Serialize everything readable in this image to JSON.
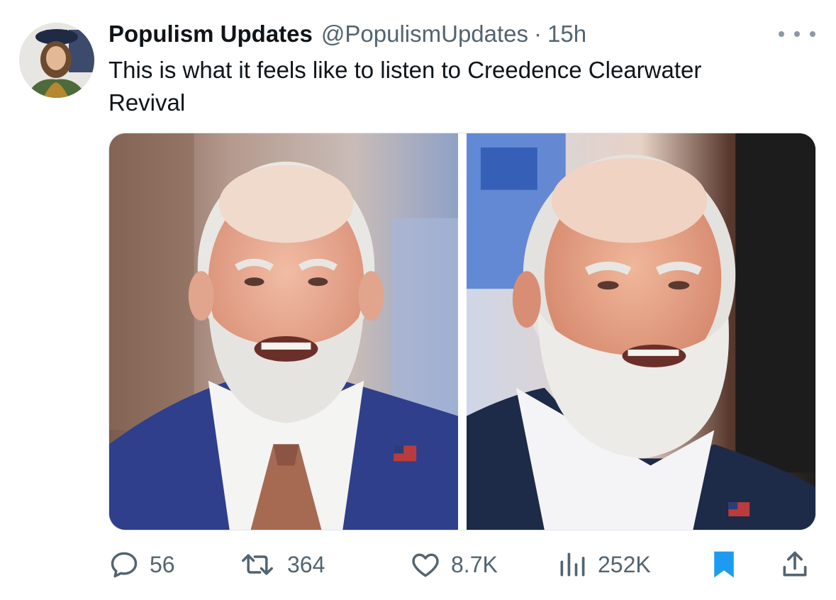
{
  "author": {
    "display_name": "Populism Updates",
    "handle": "@PopulismUpdates",
    "separator": "·",
    "time": "15h"
  },
  "tweet": {
    "text": "This is what it feels like to listen to Creedence Clearwater\nRevival"
  },
  "media": [
    {
      "description": "photo-left"
    },
    {
      "description": "photo-right"
    }
  ],
  "actions": {
    "replies": "56",
    "retweets": "364",
    "likes": "8.7K",
    "views": "252K"
  },
  "icons": {
    "reply": "speech-bubble-icon",
    "retweet": "retweet-arrows-icon",
    "like": "heart-icon",
    "views": "bar-chart-icon",
    "bookmark": "bookmark-icon",
    "share": "share-upload-icon",
    "more": "ellipsis-icon"
  },
  "colors": {
    "text_primary": "#0f1419",
    "text_secondary": "#536471",
    "bookmark_active": "#1d9bf0"
  }
}
